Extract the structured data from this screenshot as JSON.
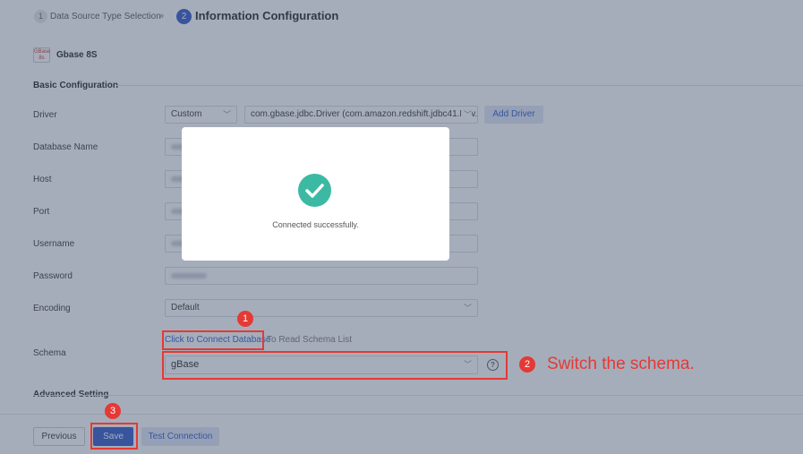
{
  "stepper": {
    "step1_num": "1",
    "step1_label": "Data Source Type Selection",
    "separator": "»",
    "step2_num": "2",
    "step2_label": "Information Configuration"
  },
  "datasource": {
    "logo_text": "GBase 8s",
    "name": "Gbase 8S"
  },
  "basic": {
    "title": "Basic Configuration",
    "driver_label": "Driver",
    "driver_type": "Custom",
    "driver_class": "com.gbase.jdbc.Driver (com.amazon.redshift.jdbc41.Driv...",
    "add_driver": "Add Driver",
    "database_name_label": "Database Name",
    "host_label": "Host",
    "port_label": "Port",
    "username_label": "Username",
    "password_label": "Password",
    "encoding_label": "Encoding",
    "encoding_value": "Default",
    "schema_label": "Schema",
    "connect_link": "Click to Connect Database",
    "connect_rest": "To Read Schema List",
    "schema_value": "gBase"
  },
  "advanced": {
    "title": "Advanced Setting"
  },
  "footer": {
    "previous": "Previous",
    "save": "Save",
    "test_connection": "Test Connection"
  },
  "modal": {
    "message": "Connected successfully."
  },
  "annotations": {
    "num1": "1",
    "num2": "2",
    "num3": "3",
    "switch_text": "Switch the schema.",
    "color": "#e53935"
  },
  "colors": {
    "primary": "#2b55c8",
    "success": "#3cb9a3"
  }
}
